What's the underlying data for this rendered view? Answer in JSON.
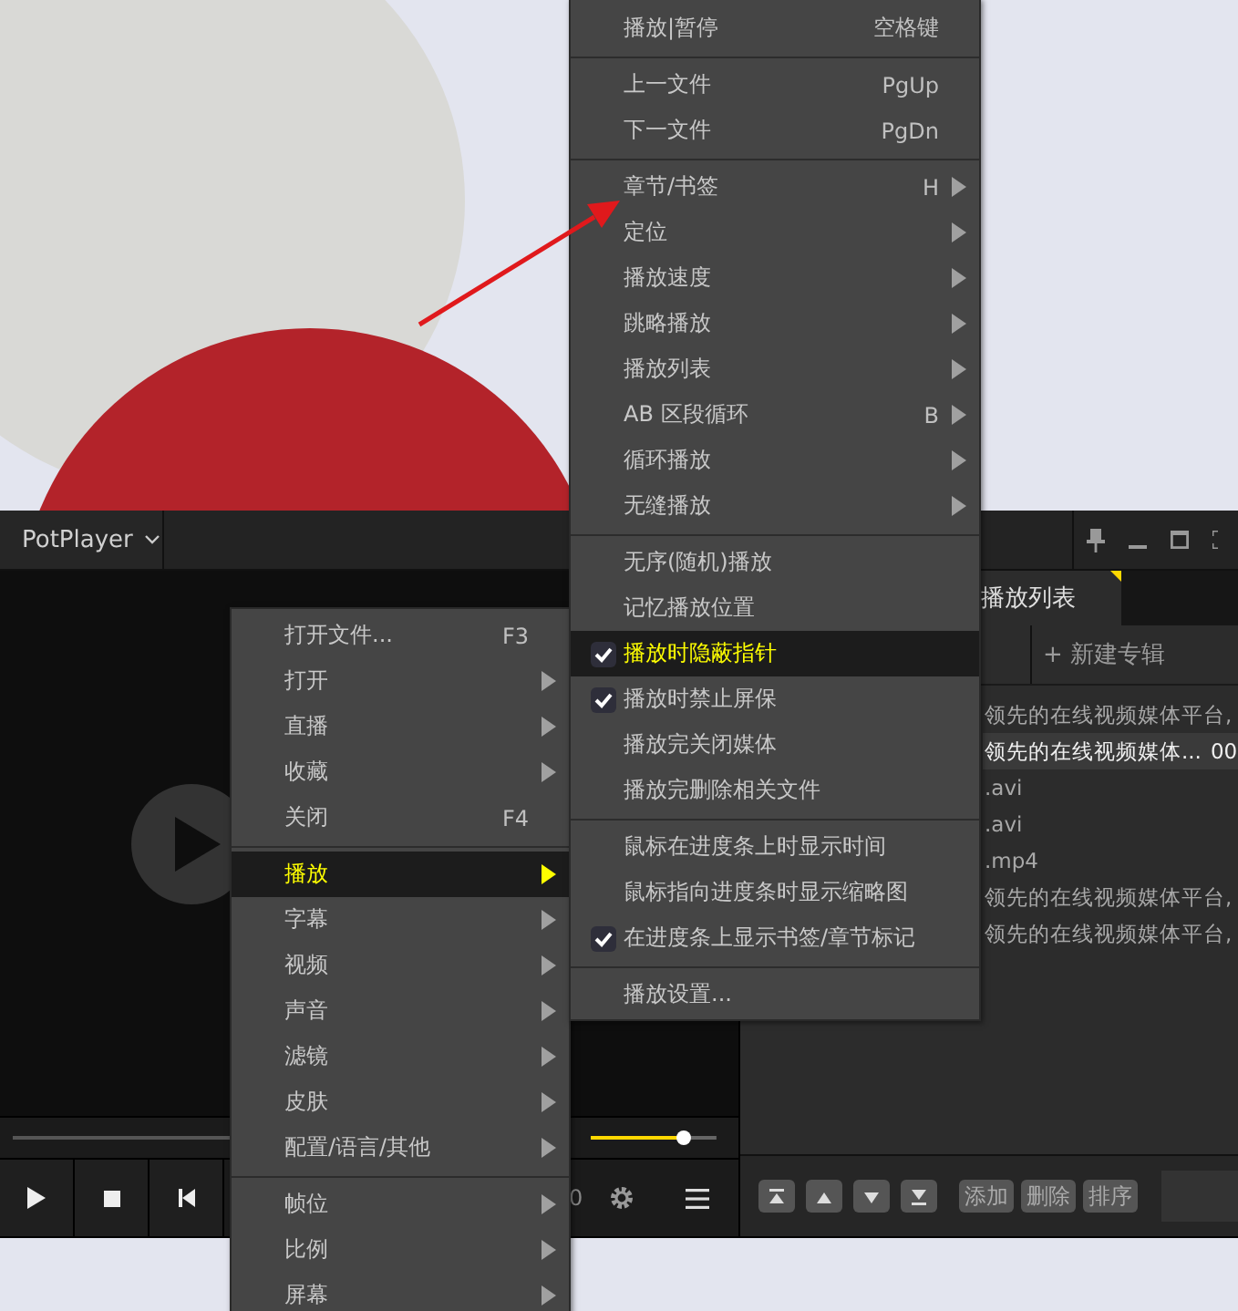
{
  "player": {
    "title": "PotPlayer",
    "time_fragment": "0",
    "volume": {
      "level": 0.74
    },
    "playlist": {
      "tabs": [
        {
          "label": "播放列表",
          "selected": true
        }
      ],
      "new_album_button": "+ 新建专辑",
      "rows": [
        {
          "title": "领先的在线视频媒体平台,",
          "selected": false
        },
        {
          "title": "领先的在线视频媒体...",
          "duration": "00",
          "selected": true
        },
        {
          "title": ".avi",
          "selected": false
        },
        {
          "title": ".avi",
          "selected": false
        },
        {
          "title": ".mp4",
          "selected": false
        },
        {
          "title": "领先的在线视频媒体平台,",
          "selected": false
        },
        {
          "title": "领先的在线视频媒体平台,",
          "selected": false
        }
      ],
      "buttons": [
        "添加",
        "删除",
        "排序"
      ]
    }
  },
  "main_menu": {
    "items": [
      {
        "kind": "item",
        "label": "打开文件...",
        "shortcut": "F3",
        "submenu": false,
        "selected": false
      },
      {
        "kind": "item",
        "label": "打开",
        "submenu": true,
        "selected": false
      },
      {
        "kind": "item",
        "label": "直播",
        "submenu": true,
        "selected": false
      },
      {
        "kind": "item",
        "label": "收藏",
        "submenu": true,
        "selected": false
      },
      {
        "kind": "item",
        "label": "关闭",
        "shortcut": "F4",
        "submenu": false,
        "selected": false
      },
      {
        "kind": "separator"
      },
      {
        "kind": "item",
        "label": "播放",
        "submenu": true,
        "selected": true
      },
      {
        "kind": "item",
        "label": "字幕",
        "submenu": true,
        "selected": false
      },
      {
        "kind": "item",
        "label": "视频",
        "submenu": true,
        "selected": false
      },
      {
        "kind": "item",
        "label": "声音",
        "submenu": true,
        "selected": false
      },
      {
        "kind": "item",
        "label": "滤镜",
        "submenu": true,
        "selected": false
      },
      {
        "kind": "item",
        "label": "皮肤",
        "submenu": true,
        "selected": false
      },
      {
        "kind": "item",
        "label": "配置/语言/其他",
        "submenu": true,
        "selected": false
      },
      {
        "kind": "separator"
      },
      {
        "kind": "item",
        "label": "帧位",
        "submenu": true,
        "selected": false
      },
      {
        "kind": "item",
        "label": "比例",
        "submenu": true,
        "selected": false
      },
      {
        "kind": "item",
        "label": "屏幕",
        "submenu": true,
        "selected": false
      }
    ]
  },
  "play_submenu": {
    "items": [
      {
        "kind": "item",
        "label": "播放|暂停",
        "shortcut": "空格键",
        "submenu": false,
        "checked": false,
        "selected": false
      },
      {
        "kind": "separator"
      },
      {
        "kind": "item",
        "label": "上一文件",
        "shortcut": "PgUp",
        "submenu": false,
        "checked": false,
        "selected": false
      },
      {
        "kind": "item",
        "label": "下一文件",
        "shortcut": "PgDn",
        "submenu": false,
        "checked": false,
        "selected": false
      },
      {
        "kind": "separator"
      },
      {
        "kind": "item",
        "label": "章节/书签",
        "shortcut": "H",
        "submenu": true,
        "checked": false,
        "selected": false
      },
      {
        "kind": "item",
        "label": "定位",
        "submenu": true,
        "checked": false,
        "selected": false
      },
      {
        "kind": "item",
        "label": "播放速度",
        "submenu": true,
        "checked": false,
        "selected": false
      },
      {
        "kind": "item",
        "label": "跳略播放",
        "submenu": true,
        "checked": false,
        "selected": false
      },
      {
        "kind": "item",
        "label": "播放列表",
        "submenu": true,
        "checked": false,
        "selected": false
      },
      {
        "kind": "item",
        "label": "AB 区段循环",
        "shortcut": "B",
        "submenu": true,
        "checked": false,
        "selected": false
      },
      {
        "kind": "item",
        "label": "循环播放",
        "submenu": true,
        "checked": false,
        "selected": false
      },
      {
        "kind": "item",
        "label": "无缝播放",
        "submenu": true,
        "checked": false,
        "selected": false
      },
      {
        "kind": "separator"
      },
      {
        "kind": "item",
        "label": "无序(随机)播放",
        "submenu": false,
        "checked": false,
        "selected": false
      },
      {
        "kind": "item",
        "label": "记忆播放位置",
        "submenu": false,
        "checked": false,
        "selected": false
      },
      {
        "kind": "item",
        "label": "播放时隐蔽指针",
        "submenu": false,
        "checked": true,
        "selected": true
      },
      {
        "kind": "item",
        "label": "播放时禁止屏保",
        "submenu": false,
        "checked": true,
        "selected": false
      },
      {
        "kind": "item",
        "label": "播放完关闭媒体",
        "submenu": false,
        "checked": false,
        "selected": false
      },
      {
        "kind": "item",
        "label": "播放完删除相关文件",
        "submenu": false,
        "checked": false,
        "selected": false
      },
      {
        "kind": "separator"
      },
      {
        "kind": "item",
        "label": "鼠标在进度条上时显示时间",
        "submenu": false,
        "checked": false,
        "selected": false
      },
      {
        "kind": "item",
        "label": "鼠标指向进度条时显示缩略图",
        "submenu": false,
        "checked": false,
        "selected": false
      },
      {
        "kind": "item",
        "label": "在进度条上显示书签/章节标记",
        "submenu": false,
        "checked": true,
        "selected": false
      },
      {
        "kind": "separator"
      },
      {
        "kind": "item",
        "label": "播放设置...",
        "submenu": false,
        "checked": false,
        "selected": false
      }
    ]
  }
}
